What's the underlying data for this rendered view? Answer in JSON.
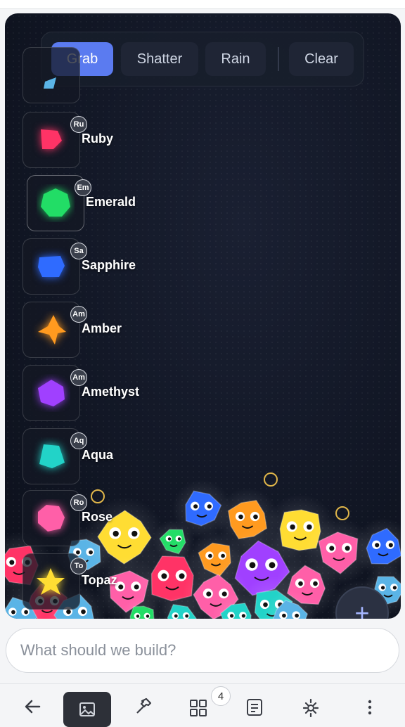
{
  "toolbar": {
    "grab_label": "Grab",
    "shatter_label": "Shatter",
    "rain_label": "Rain",
    "clear_label": "Clear"
  },
  "gems": [
    {
      "abbr": "Ru",
      "name": "Ruby",
      "color": "#ff3366"
    },
    {
      "abbr": "Em",
      "name": "Emerald",
      "color": "#22dd66"
    },
    {
      "abbr": "Sa",
      "name": "Sapphire",
      "color": "#2f6bff"
    },
    {
      "abbr": "Am",
      "name": "Amber",
      "color": "#ff9a1f"
    },
    {
      "abbr": "Am",
      "name": "Amethyst",
      "color": "#a040ff"
    },
    {
      "abbr": "Aq",
      "name": "Aqua",
      "color": "#22d3c8"
    },
    {
      "abbr": "Ro",
      "name": "Rose",
      "color": "#ff5fa8"
    },
    {
      "abbr": "To",
      "name": "Topaz",
      "color": "#ffdd33"
    }
  ],
  "partial_gem_color": "#5ab4e6",
  "accent": "#5b7bf0",
  "prompt": {
    "placeholder": "What should we build?"
  },
  "nav": {
    "tasks_badge": "4"
  },
  "icons": [
    "back-arrow-icon",
    "image-icon",
    "hammer-icon",
    "grid-icon",
    "document-icon",
    "gear-icon",
    "more-vertical-icon",
    "plus-icon"
  ]
}
